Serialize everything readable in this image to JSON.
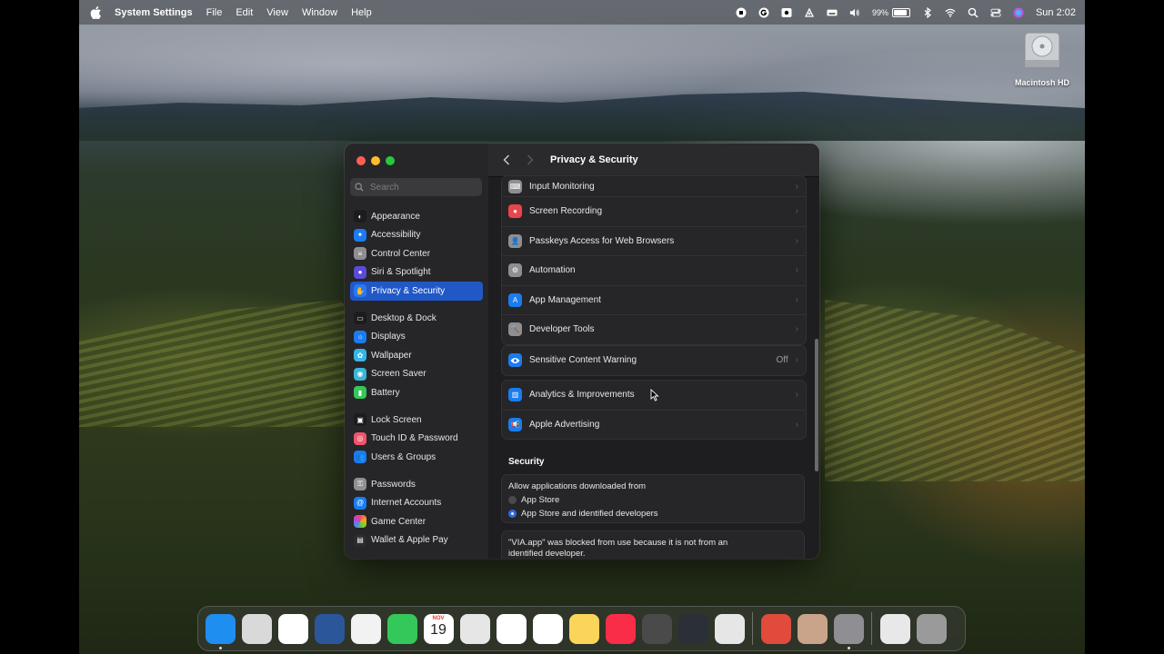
{
  "menubar": {
    "app_name": "System Settings",
    "menus": [
      "File",
      "Edit",
      "View",
      "Window",
      "Help"
    ],
    "battery_percent": "99%",
    "clock": "Sun 2:02"
  },
  "desktop": {
    "drive_label": "Macintosh HD"
  },
  "window": {
    "title": "Privacy & Security",
    "search_placeholder": "Search",
    "sidebar": [
      {
        "label": "Appearance",
        "icon": "appearance-icon",
        "color": "#1c1c1e",
        "group": 1
      },
      {
        "label": "Accessibility",
        "icon": "accessibility-icon",
        "color": "#1a7cf0",
        "group": 1
      },
      {
        "label": "Control Center",
        "icon": "control-center-icon",
        "color": "#8e8e93",
        "group": 1
      },
      {
        "label": "Siri & Spotlight",
        "icon": "siri-icon",
        "color": "#5b4bd6",
        "group": 1
      },
      {
        "label": "Privacy & Security",
        "icon": "hand-icon",
        "color": "#2a78f1",
        "group": 1,
        "active": true
      },
      {
        "label": "Desktop & Dock",
        "icon": "dock-icon",
        "color": "#1c1c1e",
        "group": 2
      },
      {
        "label": "Displays",
        "icon": "displays-icon",
        "color": "#1a7cf0",
        "group": 2
      },
      {
        "label": "Wallpaper",
        "icon": "wallpaper-icon",
        "color": "#35b5e8",
        "group": 2
      },
      {
        "label": "Screen Saver",
        "icon": "screensaver-icon",
        "color": "#39b7d6",
        "group": 2
      },
      {
        "label": "Battery",
        "icon": "battery-icon",
        "color": "#34c759",
        "group": 2
      },
      {
        "label": "Lock Screen",
        "icon": "lock-screen-icon",
        "color": "#1c1c1e",
        "group": 3
      },
      {
        "label": "Touch ID & Password",
        "icon": "fingerprint-icon",
        "color": "#f0556e",
        "group": 3
      },
      {
        "label": "Users & Groups",
        "icon": "users-icon",
        "color": "#1a7cf0",
        "group": 3
      },
      {
        "label": "Passwords",
        "icon": "key-icon",
        "color": "#8e8e93",
        "group": 4
      },
      {
        "label": "Internet Accounts",
        "icon": "at-icon",
        "color": "#1a7cf0",
        "group": 4
      },
      {
        "label": "Game Center",
        "icon": "game-center-icon",
        "color": "#e8e8e8",
        "group": 4
      },
      {
        "label": "Wallet & Apple Pay",
        "icon": "wallet-icon",
        "color": "#2c2c2e",
        "group": 4
      }
    ],
    "privacy_rows": [
      {
        "label": "Input Monitoring",
        "icon": "keyboard-icon",
        "color": "#8e8e93"
      },
      {
        "label": "Screen Recording",
        "icon": "record-icon",
        "color": "#e9454b"
      },
      {
        "label": "Passkeys Access for Web Browsers",
        "icon": "person-key-icon",
        "color": "#8e8e93"
      },
      {
        "label": "Automation",
        "icon": "gears-icon",
        "color": "#8e8e93"
      },
      {
        "label": "App Management",
        "icon": "app-store-icon",
        "color": "#1a7cf0"
      },
      {
        "label": "Developer Tools",
        "icon": "hammer-icon",
        "color": "#8e8e93"
      }
    ],
    "sensitive_row": {
      "label": "Sensitive Content Warning",
      "value": "Off",
      "icon": "eye-icon",
      "color": "#1a7cf0"
    },
    "analytics_rows": [
      {
        "label": "Analytics & Improvements",
        "icon": "chart-icon",
        "color": "#1a7cf0"
      },
      {
        "label": "Apple Advertising",
        "icon": "megaphone-icon",
        "color": "#1a7cf0"
      }
    ],
    "security": {
      "heading": "Security",
      "allow_label": "Allow applications downloaded from",
      "options": [
        {
          "label": "App Store",
          "selected": false
        },
        {
          "label": "App Store and identified developers",
          "selected": true
        }
      ],
      "blocked_message": "\"VIA.app\" was blocked from use because it is not from an identified developer."
    }
  },
  "dock": {
    "apps": [
      {
        "name": "finder-icon",
        "color": "#1e8ef0",
        "running": true
      },
      {
        "name": "launchpad-icon",
        "color": "#d9d9d9",
        "running": false
      },
      {
        "name": "chrome-icon",
        "color": "#ffffff",
        "running": false
      },
      {
        "name": "word-icon",
        "color": "#2b579a",
        "running": false
      },
      {
        "name": "proxyman-icon",
        "color": "#f2f2f2",
        "running": false
      },
      {
        "name": "messages-icon",
        "color": "#34c759",
        "running": false
      },
      {
        "name": "calendar-icon",
        "color": "#ffffff",
        "running": false,
        "month": "NOV",
        "day": "19"
      },
      {
        "name": "screenshot-icon",
        "color": "#e6e6e6",
        "running": false
      },
      {
        "name": "freeform-icon",
        "color": "#ffffff",
        "running": false
      },
      {
        "name": "reminders-icon",
        "color": "#ffffff",
        "running": false
      },
      {
        "name": "notes-icon",
        "color": "#fbd45a",
        "running": false
      },
      {
        "name": "music-icon",
        "color": "#fa2d48",
        "running": false
      },
      {
        "name": "photo-booth-icon",
        "color": "#4a4a4a",
        "running": false
      },
      {
        "name": "davinci-resolve-icon",
        "color": "#2b2f38",
        "running": false
      },
      {
        "name": "disk-utility-icon",
        "color": "#e6e6e6",
        "running": false
      },
      {
        "name": "cleanmymac-icon",
        "color": "#e04b3c",
        "running": false
      },
      {
        "name": "via-icon",
        "color": "#c9a48a",
        "running": false
      },
      {
        "name": "system-settings-icon",
        "color": "#8e8e93",
        "running": true
      }
    ],
    "trailing": [
      {
        "name": "document-icon",
        "color": "#e8e8e8"
      },
      {
        "name": "trash-icon",
        "color": "#9a9a9a"
      }
    ]
  }
}
